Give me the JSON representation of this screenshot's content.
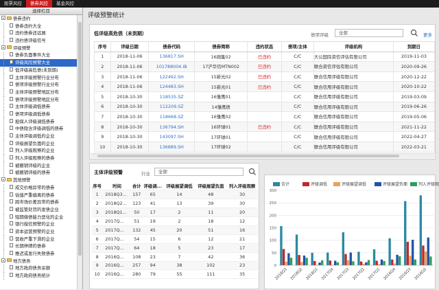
{
  "topnav": {
    "tabs": [
      "股票风控",
      "债券风控",
      "基金风控"
    ],
    "active": 1
  },
  "sidebar": {
    "header": "选择栏目",
    "items": [
      {
        "type": "cat",
        "label": "债券违约"
      },
      {
        "type": "item",
        "label": "债券违约大全"
      },
      {
        "type": "item",
        "label": "违约债券还远展"
      },
      {
        "type": "item",
        "label": "违约债评级信号"
      },
      {
        "type": "cat",
        "label": "评级预警"
      },
      {
        "type": "item",
        "label": "债券负面事件大全"
      },
      {
        "type": "item",
        "label": "评级风险预警大全",
        "selected": true
      },
      {
        "type": "item",
        "label": "低评级高危债(未到期)"
      },
      {
        "type": "item",
        "label": "主体评级预警行业分布"
      },
      {
        "type": "item",
        "label": "债项评级预警行业分布"
      },
      {
        "type": "item",
        "label": "主体评级预警地区分布"
      },
      {
        "type": "item",
        "label": "债项评级预警地区分布"
      },
      {
        "type": "item",
        "label": "主体评级调低债券"
      },
      {
        "type": "item",
        "label": "债项评级调低债券"
      },
      {
        "type": "item",
        "label": "担保人评级调低债券"
      },
      {
        "type": "item",
        "label": "中债隐含评级调低的债券"
      },
      {
        "type": "item",
        "label": "主体评级调低的企业"
      },
      {
        "type": "item",
        "label": "评级展望负面的企业"
      },
      {
        "type": "item",
        "label": "列入评级观察的企业"
      },
      {
        "type": "item",
        "label": "列入评级观察的债券"
      },
      {
        "type": "item",
        "label": "被撤销评级的企业"
      },
      {
        "type": "item",
        "label": "被撤销评级的债券"
      },
      {
        "type": "cat",
        "label": "其他预警"
      },
      {
        "type": "item",
        "label": "成交价格异常的债券"
      },
      {
        "type": "item",
        "label": "估值严重偏离的债券"
      },
      {
        "type": "item",
        "label": "跨市场价差异常的债券"
      },
      {
        "type": "item",
        "label": "被监管处罚的发债企业"
      },
      {
        "type": "item",
        "label": "短期偿债能力恶化的企业"
      },
      {
        "type": "item",
        "label": "银行授信预警的企业"
      },
      {
        "type": "item",
        "label": "资本运营预警的企业"
      },
      {
        "type": "item",
        "label": "营收严重下滑的企业"
      },
      {
        "type": "item",
        "label": "长期停牌的债券"
      },
      {
        "type": "item",
        "label": "推迟或发行失败债券"
      },
      {
        "type": "cat",
        "label": "地方债务"
      },
      {
        "type": "item",
        "label": "地方政府债务余额"
      },
      {
        "type": "item",
        "label": "地方政府债务统计"
      }
    ]
  },
  "main": {
    "title": "评级预警统计"
  },
  "bonds_panel": {
    "title": "低评级高危债（未到期）",
    "filter_label": "债项评级",
    "filter_value": "全部",
    "more": "更多",
    "columns": [
      "序号",
      "评级日期",
      "债券代码",
      "债券简称",
      "违约状态",
      "债项/主体",
      "评级机构",
      "到期日"
    ],
    "rows": [
      [
        "1",
        "2018-11-06",
        "136817.SH",
        "16刚集02",
        "已违约",
        "C/C",
        "大公国际资信评估有限公司",
        "2019-11-03"
      ],
      [
        "2",
        "2018-11-06",
        "101788004.IB",
        "17沪华信MTN002",
        "已违约",
        "C/C",
        "联合资信评估有限公司",
        "2020-09-26"
      ],
      [
        "3",
        "2018-11-06",
        "122492.SH",
        "15新光02",
        "已违约",
        "C/C",
        "联合信用评级有限公司",
        "2020-12-22"
      ],
      [
        "4",
        "2018-11-06",
        "124483.SH",
        "15新光01",
        "已违约",
        "C/C",
        "联合信用评级有限公司",
        "2020-10-22"
      ],
      [
        "5",
        "2018-10-30",
        "118535.SZ",
        "16雏鹰01",
        "",
        "C/C",
        "联合信用评级有限公司",
        "2019-03-09"
      ],
      [
        "6",
        "2018-10-30",
        "112209.SZ",
        "14雏鹰债",
        "",
        "C/C",
        "联合信用评级有限公司",
        "2019-06-26"
      ],
      [
        "7",
        "2018-10-30",
        "118668.SZ",
        "16雏鹰02",
        "",
        "C/C",
        "联合信用评级有限公司",
        "2019-05-06"
      ],
      [
        "8",
        "2018-10-30",
        "136794.SH",
        "16环球01",
        "已违约",
        "C/C",
        "联合信用评级有限公司",
        "2021-11-22"
      ],
      [
        "9",
        "2018-10-30",
        "143097.SH",
        "17环球01",
        "",
        "C/C",
        "联合信用评级有限公司",
        "2022-04-27"
      ],
      [
        "10",
        "2018-10-30",
        "136889.SH",
        "17环球02",
        "",
        "C/C",
        "联合信用评级有限公司",
        "2022-03-21"
      ]
    ]
  },
  "rating_panel": {
    "title": "主体评级预警",
    "filter_label": "行业",
    "filter_value": "全部",
    "columns": [
      "序号",
      "时间",
      "合计",
      "评级调...",
      "评级展望调低",
      "评级展望负面",
      "列入评级观察"
    ],
    "rows": [
      [
        "1",
        "2018Q3...",
        "157",
        "65",
        "14",
        "48",
        "30"
      ],
      [
        "2",
        "2018Q2...",
        "123",
        "41",
        "13",
        "39",
        "30"
      ],
      [
        "3",
        "2018Q1...",
        "50",
        "17",
        "2",
        "11",
        "20"
      ],
      [
        "4",
        "2017Q...",
        "51",
        "19",
        "2",
        "18",
        "12"
      ],
      [
        "5",
        "2017Q...",
        "132",
        "45",
        "20",
        "51",
        "16"
      ],
      [
        "6",
        "2017Q...",
        "54",
        "15",
        "6",
        "12",
        "21"
      ],
      [
        "7",
        "2017Q...",
        "64",
        "18",
        "5",
        "23",
        "17"
      ],
      [
        "8",
        "2016Q...",
        "108",
        "23",
        "7",
        "42",
        "36"
      ],
      [
        "9",
        "2016Q...",
        "257",
        "94",
        "38",
        "102",
        "23"
      ],
      [
        "10",
        "2016Q...",
        "280",
        "79",
        "55",
        "111",
        "35"
      ]
    ]
  },
  "chart_data": {
    "type": "bar",
    "categories": [
      "2018Q3",
      "2018Q2",
      "2018Q1",
      "2017Q4",
      "2017Q3",
      "2017Q2",
      "2017Q1",
      "2016Q4",
      "2016Q3",
      "2016Q2"
    ],
    "series": [
      {
        "name": "合计",
        "color": "#2a8aa0",
        "values": [
          157,
          123,
          50,
          51,
          132,
          54,
          64,
          108,
          257,
          280
        ]
      },
      {
        "name": "评级调低",
        "color": "#c0282a",
        "values": [
          65,
          41,
          17,
          19,
          45,
          15,
          18,
          23,
          94,
          79
        ]
      },
      {
        "name": "评级展望调低",
        "color": "#e8a060",
        "values": [
          14,
          13,
          2,
          2,
          20,
          6,
          5,
          7,
          38,
          55
        ]
      },
      {
        "name": "评级展望负面",
        "color": "#1f55a8",
        "values": [
          48,
          39,
          11,
          18,
          51,
          12,
          23,
          42,
          102,
          111
        ]
      },
      {
        "name": "列入评级观察",
        "color": "#2f9e5a",
        "values": [
          30,
          30,
          20,
          12,
          16,
          21,
          17,
          36,
          23,
          35
        ]
      }
    ],
    "ylim": [
      0,
      300
    ],
    "grid": true,
    "legend": "top"
  }
}
